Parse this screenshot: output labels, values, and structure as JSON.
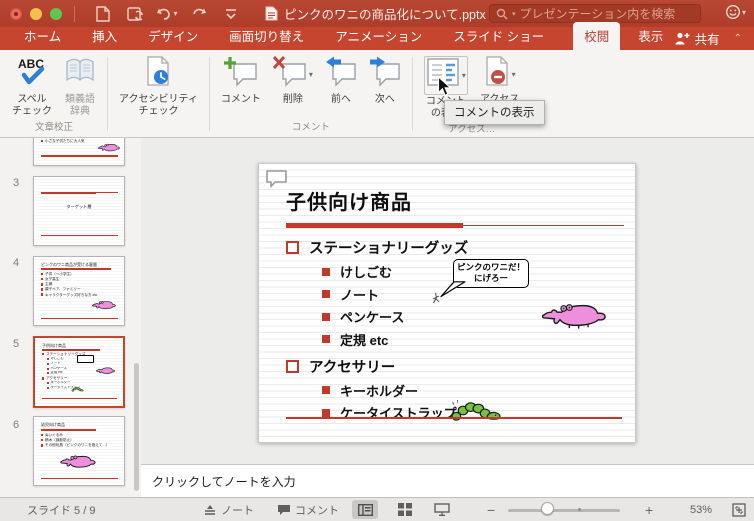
{
  "titlebar": {
    "title": "ピンクのワニの商品化について.pptx",
    "search_placeholder": "プレゼンテーション内を検索"
  },
  "tabs": {
    "items": [
      {
        "label": "ホーム"
      },
      {
        "label": "挿入"
      },
      {
        "label": "デザイン"
      },
      {
        "label": "画面切り替え"
      },
      {
        "label": "アニメーション"
      },
      {
        "label": "スライド ショー"
      },
      {
        "label": "校閲"
      },
      {
        "label": "表示"
      }
    ],
    "active": "校閲",
    "share_label": "共有"
  },
  "ribbon": {
    "buttons": {
      "spell_check": "スペル\nチェック",
      "thesaurus": "類義語\n辞典",
      "accessibility_check": "アクセシビリティ\nチェック",
      "new_comment": "コメント",
      "delete": "削除",
      "previous": "前へ",
      "next": "次へ",
      "show_comments": "コメント\nの表示",
      "access": "アクセス"
    },
    "group_labels": {
      "proofing": "文章校正",
      "comments": "コメント",
      "access": "アクセス…"
    },
    "tooltip": "コメントの表示"
  },
  "thumbnails": {
    "slides": [
      {
        "number": "",
        "bullets": [
          "小さな子供たちに大人気"
        ]
      },
      {
        "number": "3",
        "center_text": "ターゲット層"
      },
      {
        "number": "4",
        "title": "ピンクのワニ商品が受ける客層",
        "bullets": [
          "子供（〜小学生）",
          "女子高生",
          "主婦",
          "親子ペア、ファミリー",
          "キャラクターグッズ好きな方 etc"
        ]
      },
      {
        "number": "5",
        "selected": true,
        "title": "子供向け商品"
      },
      {
        "number": "6",
        "title": "幼児向け商品",
        "bullets": [
          "ぬいぐるみ",
          "積木（誤飲防止）",
          "その他玩具（ピンクのワニを抱えて…）"
        ]
      }
    ]
  },
  "slide": {
    "title": "子供向け商品",
    "bullets": [
      {
        "level": 1,
        "text": "ステーショナリーグッズ"
      },
      {
        "level": 2,
        "text": "けしごむ"
      },
      {
        "level": 2,
        "text": "ノート"
      },
      {
        "level": 2,
        "text": "ペンケース"
      },
      {
        "level": 2,
        "text": "定規 etc"
      },
      {
        "level": 1,
        "text": "アクセサリー"
      },
      {
        "level": 2,
        "text": "キーホルダー"
      },
      {
        "level": 2,
        "text": "ケータイストラップ"
      }
    ],
    "bubble": {
      "line1": "ピンクのワニだ！",
      "line2": "にげろー"
    }
  },
  "notes": {
    "placeholder": "クリックしてノートを入力"
  },
  "statusbar": {
    "slide_counter": "スライド 5 / 9",
    "notes_label": "ノート",
    "comments_label": "コメント",
    "zoom_level": "53%"
  },
  "colors": {
    "accent_red": "#c0392b",
    "ribbon_red": "#c5452f",
    "croc_pink": "#ee8fdc",
    "caterpillar_green": "#76c043"
  }
}
